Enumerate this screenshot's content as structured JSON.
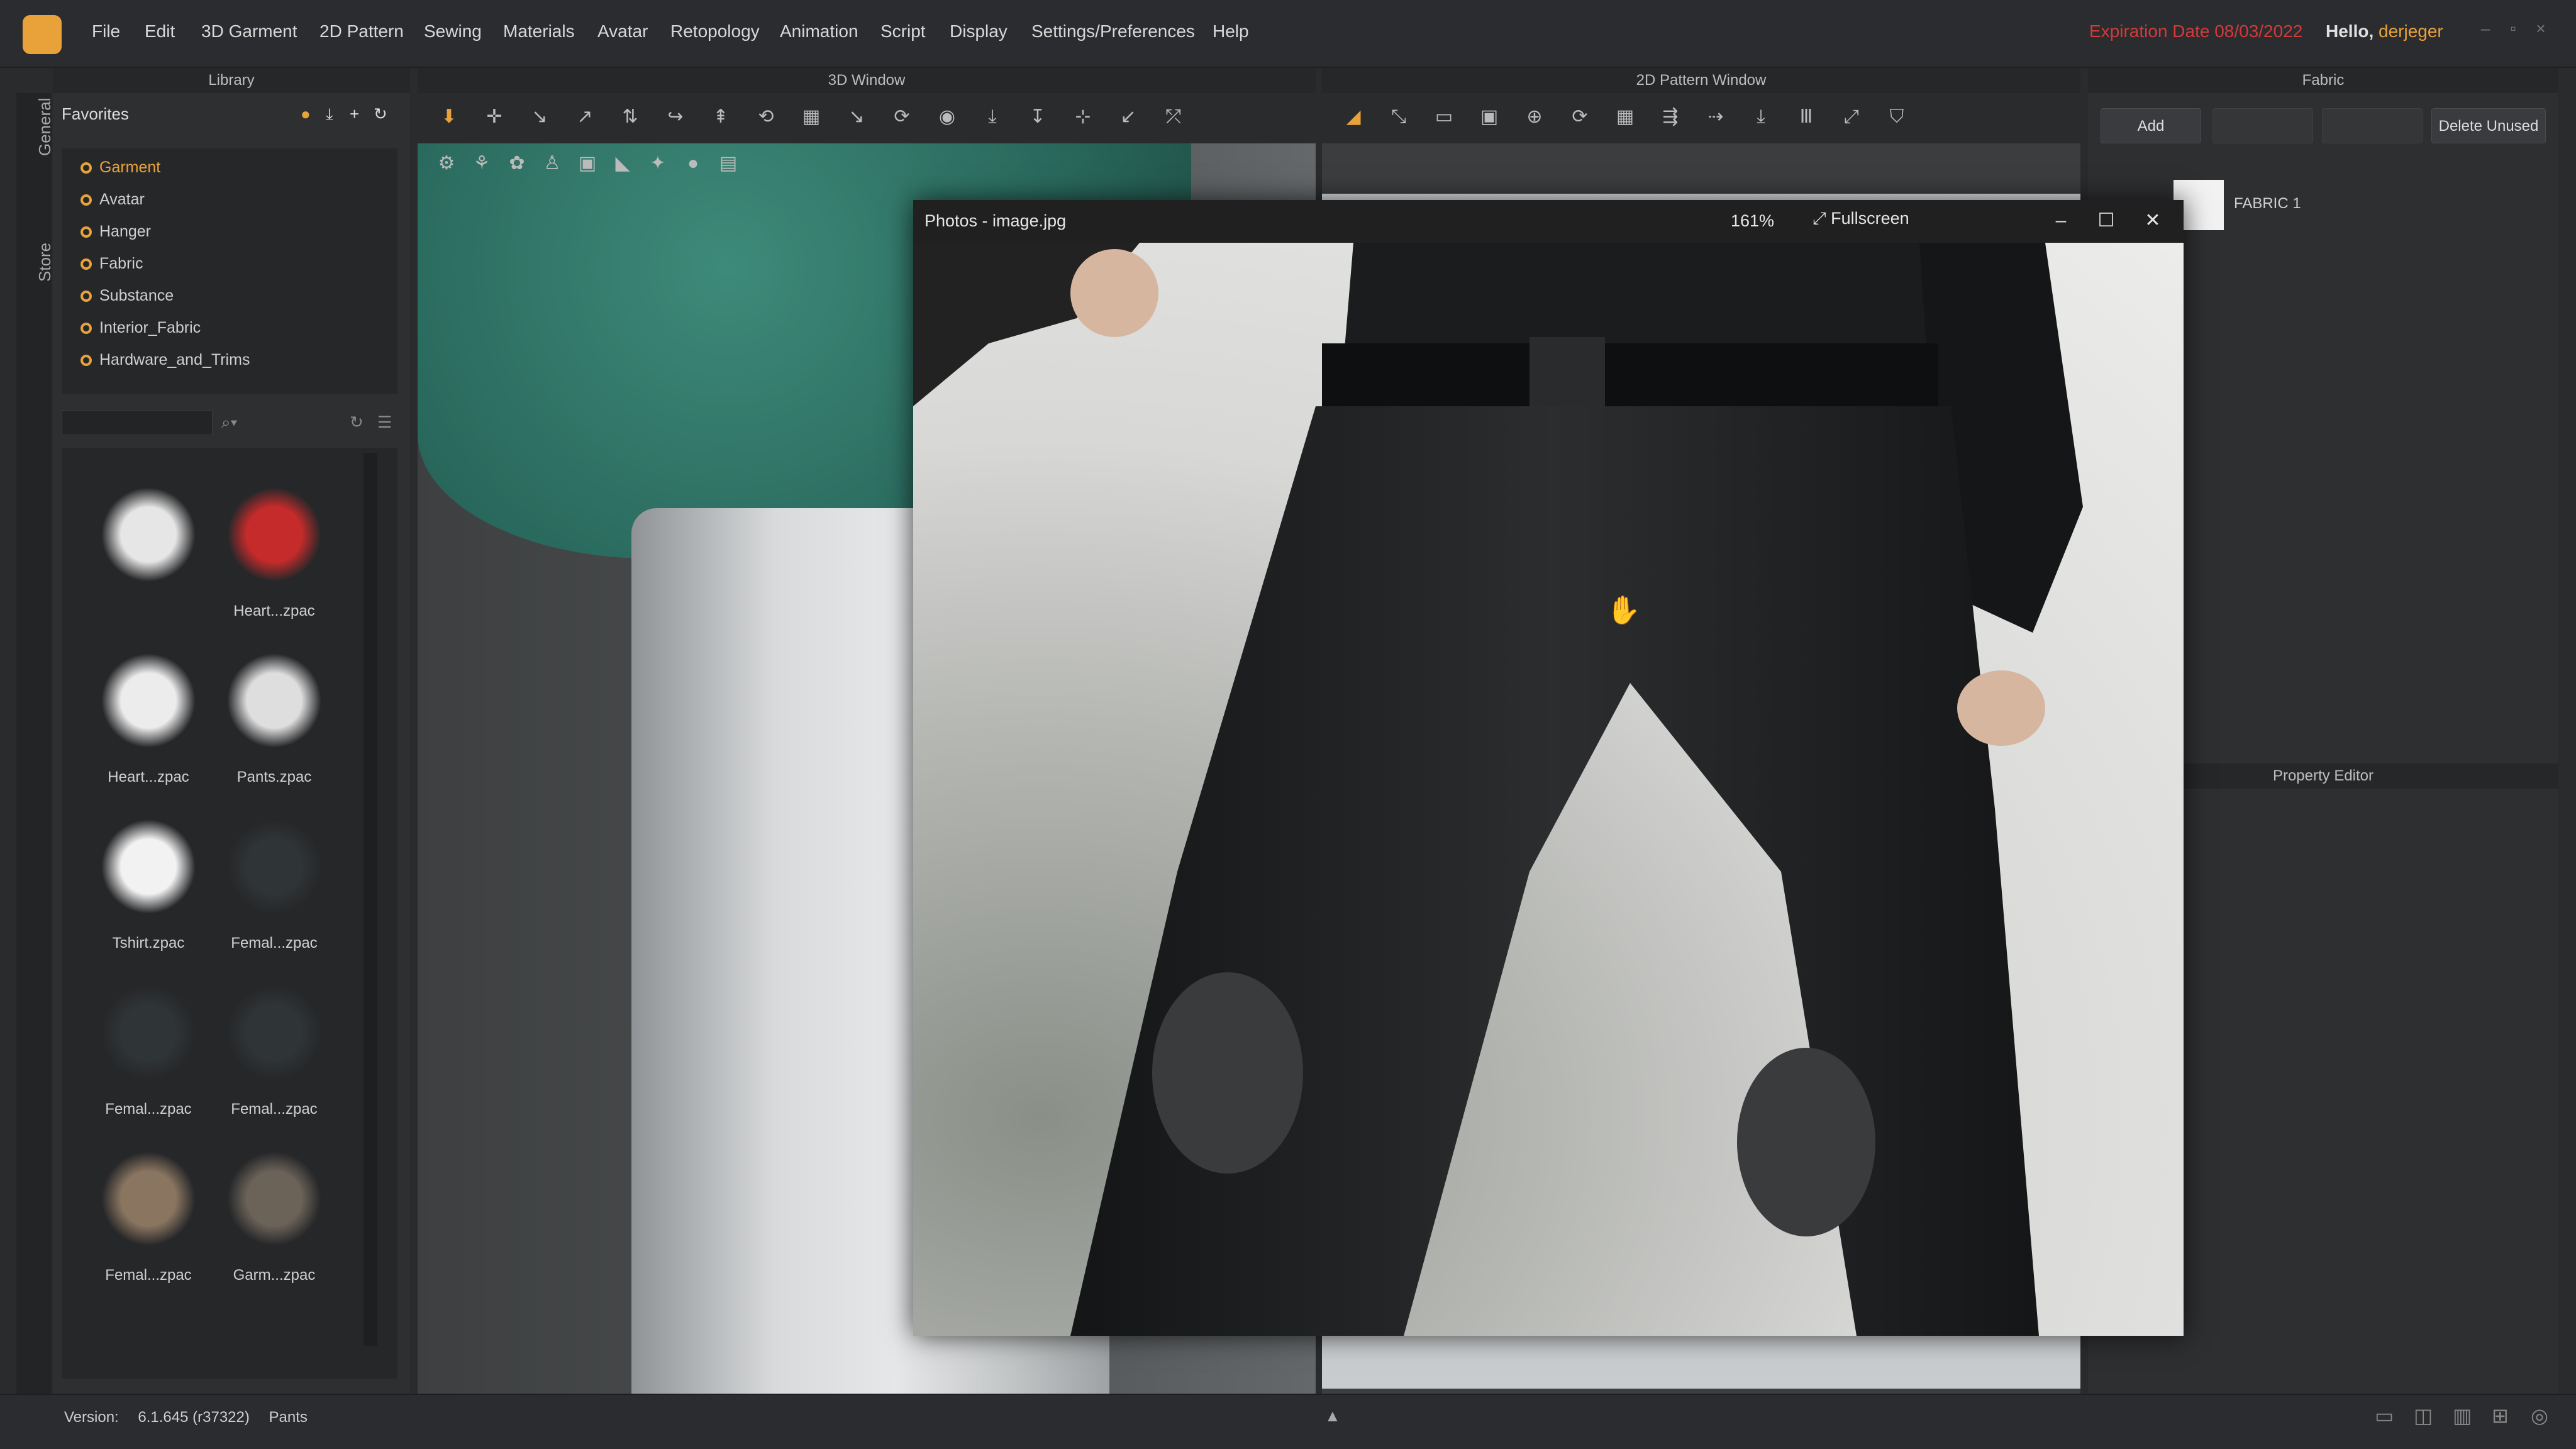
{
  "menu": {
    "items": [
      "File",
      "Edit",
      "3D Garment",
      "2D Pattern",
      "Sewing",
      "Materials",
      "Avatar",
      "Retopology",
      "Animation",
      "Script",
      "Display",
      "Settings/Preferences",
      "Help"
    ],
    "expiration": "Expiration Date 08/03/2022",
    "hello_prefix": "Hello,",
    "username": "derjeger"
  },
  "panels": {
    "library": "Library",
    "window3d": "3D Window",
    "pattern2d": "2D Pattern Window",
    "fabric": "Fabric",
    "property_editor": "Property Editor"
  },
  "side_tabs": [
    "General",
    "Store"
  ],
  "library": {
    "favorites_label": "Favorites",
    "favorites": [
      "Garment",
      "Avatar",
      "Hanger",
      "Fabric",
      "Substance",
      "Interior_Fabric",
      "Hardware_and_Trims"
    ],
    "selected": "Garment",
    "thumbnails": [
      {
        "label": "",
        "icon": "fold-icon"
      },
      {
        "label": "Heart...zpac",
        "icon": "cap-icon"
      },
      {
        "label": "Heart...zpac",
        "icon": "hat-icon"
      },
      {
        "label": "Pants.zpac",
        "icon": "pants-icon"
      },
      {
        "label": "Tshirt.zpac",
        "icon": "tshirt-icon"
      },
      {
        "label": "Femal...zpac",
        "icon": "dress-icon"
      },
      {
        "label": "Femal...zpac",
        "icon": "dress-icon"
      },
      {
        "label": "Femal...zpac",
        "icon": "dress-icon"
      },
      {
        "label": "Femal...zpac",
        "icon": "skirt-icon"
      },
      {
        "label": "Garm...zpac",
        "icon": "mannequin-icon"
      }
    ]
  },
  "fabric": {
    "buttons": [
      "Add",
      "",
      "",
      "Delete Unused"
    ],
    "items": [
      {
        "name": "FABRIC 1",
        "color": "#f2f2f2"
      }
    ]
  },
  "photo_viewer": {
    "title": "Photos - image.jpg",
    "zoom": "161%",
    "fullscreen": "Fullscreen"
  },
  "status": {
    "version_label": "Version:",
    "version": "6.1.645 (r37322)",
    "file": "Pants"
  },
  "colors": {
    "accent": "#e9a23a",
    "expiration": "#d33a3a"
  }
}
